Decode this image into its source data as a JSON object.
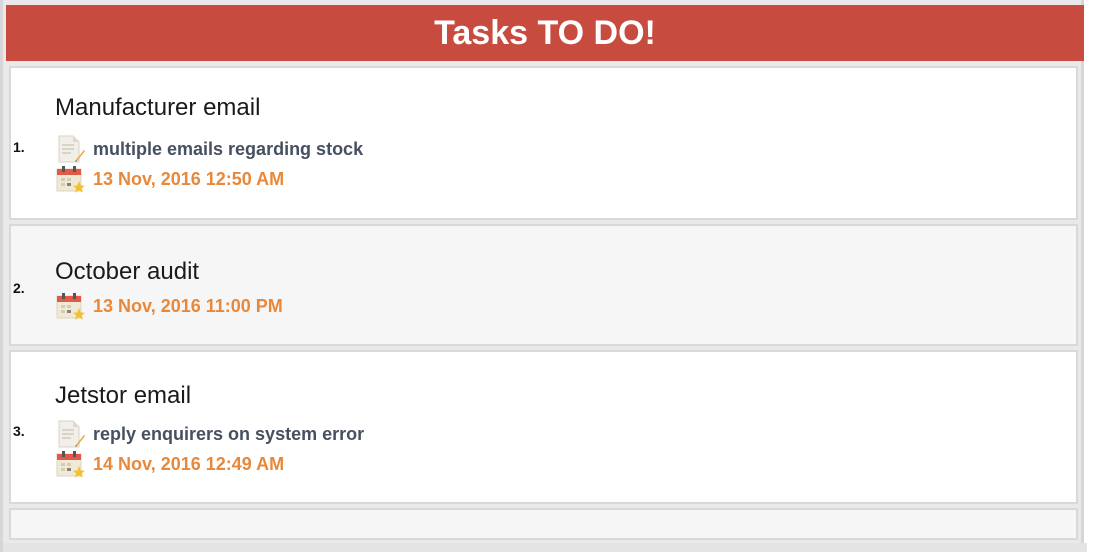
{
  "header": {
    "title": "Tasks TO DO!"
  },
  "colors": {
    "header_bg": "#c84b40",
    "date_text": "#e8883a",
    "note_text": "#465060"
  },
  "tasks": [
    {
      "number": "1.",
      "title": "Manufacturer email",
      "note": "multiple emails regarding stock",
      "date": "13 Nov, 2016 12:50 AM",
      "note_icon": "note-pencil-icon",
      "date_icon": "calendar-star-icon"
    },
    {
      "number": "2.",
      "title": "October audit",
      "date": "13 Nov, 2016 11:00 PM",
      "date_icon": "calendar-star-icon"
    },
    {
      "number": "3.",
      "title": "Jetstor email",
      "note": "reply enquirers on system error",
      "date": "14 Nov, 2016 12:49 AM",
      "note_icon": "note-pencil-icon",
      "date_icon": "calendar-star-icon"
    }
  ]
}
